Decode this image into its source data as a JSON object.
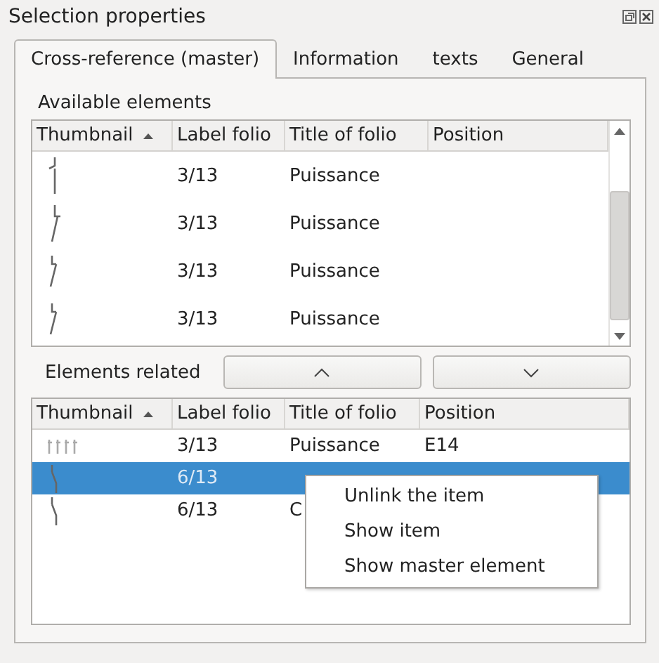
{
  "window": {
    "title": "Selection properties"
  },
  "tabs": [
    {
      "label": "Cross-reference (master)",
      "selected": true
    },
    {
      "label": "Information",
      "selected": false
    },
    {
      "label": "texts",
      "selected": false
    },
    {
      "label": "General",
      "selected": false
    }
  ],
  "available": {
    "label": "Available elements",
    "columns": [
      "Thumbnail",
      "Label folio",
      "Title of folio",
      "Position"
    ],
    "rows": [
      {
        "kind": "break",
        "label_folio": "3/13",
        "title_of_folio": "Puissance",
        "selected": false
      },
      {
        "kind": "make",
        "label_folio": "3/13",
        "title_of_folio": "Puissance",
        "selected": false
      },
      {
        "kind": "short",
        "label_folio": "3/13",
        "title_of_folio": "Puissance",
        "selected": false
      },
      {
        "kind": "short",
        "label_folio": "3/13",
        "title_of_folio": "Puissance",
        "selected": false
      }
    ]
  },
  "related": {
    "label": "Elements related",
    "columns": [
      "Thumbnail",
      "Label folio",
      "Title of folio",
      "Position"
    ],
    "rows": [
      {
        "kind": "triple",
        "label_folio": "3/13",
        "title_of_folio": "Puissance",
        "position": "E14",
        "selected": false
      },
      {
        "kind": "long",
        "label_folio": "6/13",
        "selected": true
      },
      {
        "kind": "long",
        "label_folio": "6/13",
        "title_of_folio": "C",
        "selected": false
      }
    ]
  },
  "context_menu": [
    "Unlink the item",
    "Show item",
    "Show master element"
  ]
}
